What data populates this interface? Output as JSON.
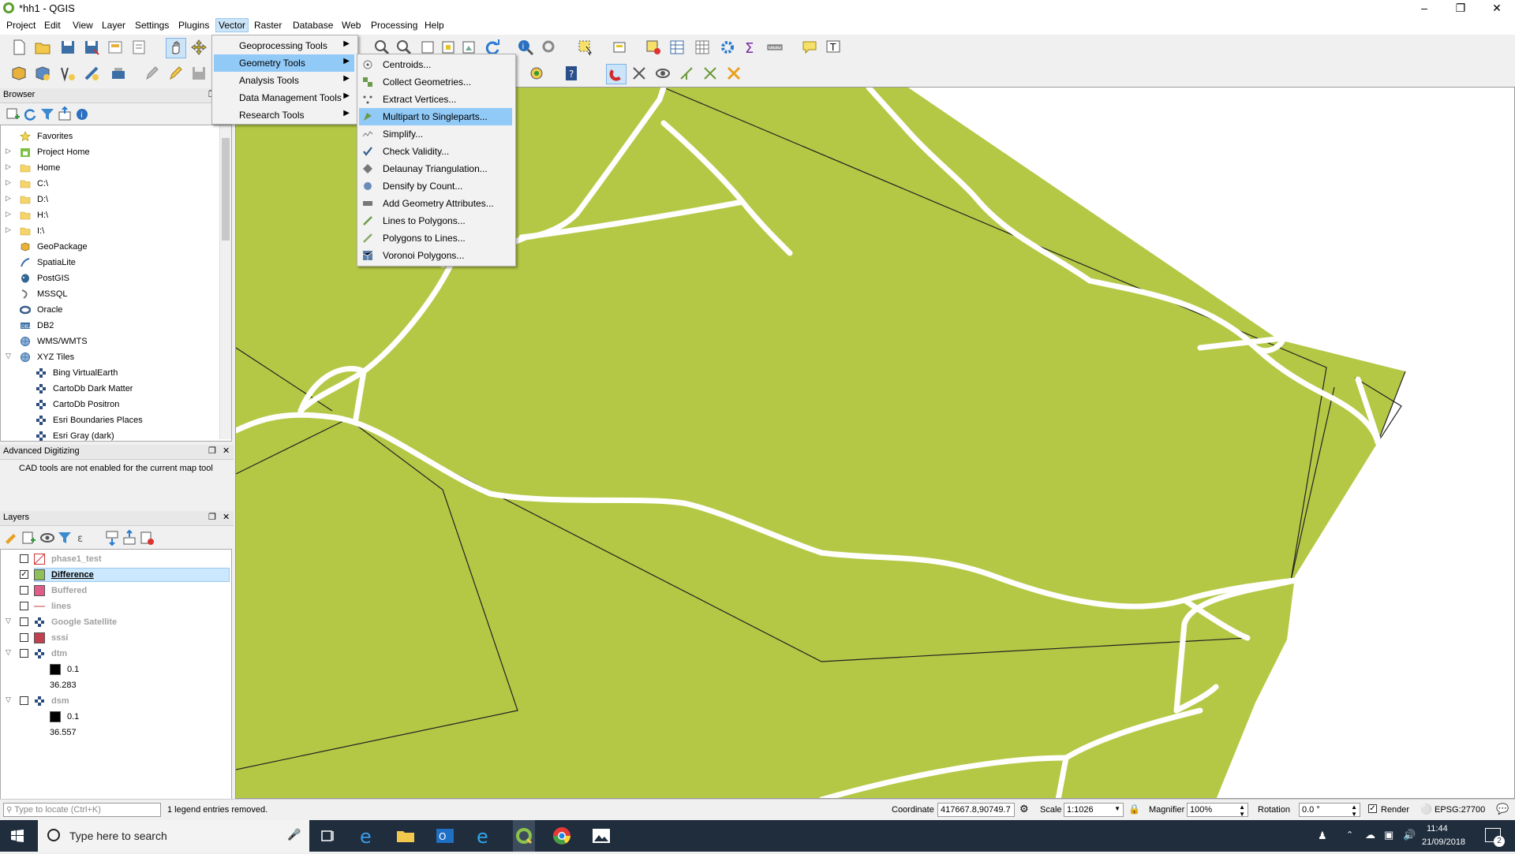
{
  "window": {
    "title": "*hh1 - QGIS"
  },
  "menubar": [
    "Project",
    "Edit",
    "View",
    "Layer",
    "Settings",
    "Plugins",
    "Vector",
    "Raster",
    "Database",
    "Web",
    "Processing",
    "Help"
  ],
  "vector_menu": {
    "items": [
      "Geoprocessing Tools",
      "Geometry Tools",
      "Analysis Tools",
      "Data Management Tools",
      "Research Tools"
    ],
    "highlighted": "Geometry Tools"
  },
  "geometry_submenu": {
    "items": [
      "Centroids...",
      "Collect Geometries...",
      "Extract Vertices...",
      "Multipart to Singleparts...",
      "Simplify...",
      "Check Validity...",
      "Delaunay Triangulation...",
      "Densify by Count...",
      "Add Geometry Attributes...",
      "Lines to Polygons...",
      "Polygons to Lines...",
      "Voronoi Polygons..."
    ],
    "highlighted": "Multipart to Singleparts..."
  },
  "browser": {
    "title": "Browser",
    "items": [
      {
        "label": "Favorites",
        "icon": "star-icon",
        "indent": 0,
        "arrow": ""
      },
      {
        "label": "Project Home",
        "icon": "project-home-icon",
        "indent": 0,
        "arrow": "▷"
      },
      {
        "label": "Home",
        "icon": "folder-icon",
        "indent": 0,
        "arrow": "▷"
      },
      {
        "label": "C:\\",
        "icon": "folder-icon",
        "indent": 0,
        "arrow": "▷"
      },
      {
        "label": "D:\\",
        "icon": "folder-icon",
        "indent": 0,
        "arrow": "▷"
      },
      {
        "label": "H:\\",
        "icon": "folder-icon",
        "indent": 0,
        "arrow": "▷"
      },
      {
        "label": "I:\\",
        "icon": "folder-icon",
        "indent": 0,
        "arrow": "▷"
      },
      {
        "label": "GeoPackage",
        "icon": "geopackage-icon",
        "indent": 0,
        "arrow": ""
      },
      {
        "label": "SpatiaLite",
        "icon": "spatialite-icon",
        "indent": 0,
        "arrow": ""
      },
      {
        "label": "PostGIS",
        "icon": "postgis-icon",
        "indent": 0,
        "arrow": ""
      },
      {
        "label": "MSSQL",
        "icon": "mssql-icon",
        "indent": 0,
        "arrow": ""
      },
      {
        "label": "Oracle",
        "icon": "oracle-icon",
        "indent": 0,
        "arrow": ""
      },
      {
        "label": "DB2",
        "icon": "db2-icon",
        "indent": 0,
        "arrow": ""
      },
      {
        "label": "WMS/WMTS",
        "icon": "wms-icon",
        "indent": 0,
        "arrow": ""
      },
      {
        "label": "XYZ Tiles",
        "icon": "xyz-icon",
        "indent": 0,
        "arrow": "▽"
      },
      {
        "label": "Bing VirtualEarth",
        "icon": "tile-icon",
        "indent": 1,
        "arrow": ""
      },
      {
        "label": "CartoDb Dark Matter",
        "icon": "tile-icon",
        "indent": 1,
        "arrow": ""
      },
      {
        "label": "CartoDb Positron",
        "icon": "tile-icon",
        "indent": 1,
        "arrow": ""
      },
      {
        "label": "Esri Boundaries Places",
        "icon": "tile-icon",
        "indent": 1,
        "arrow": ""
      },
      {
        "label": "Esri Gray (dark)",
        "icon": "tile-icon",
        "indent": 1,
        "arrow": ""
      }
    ]
  },
  "advanced_digitizing": {
    "title": "Advanced Digitizing",
    "message": "CAD tools are not enabled for the current map tool"
  },
  "layers": {
    "title": "Layers",
    "items": [
      {
        "label": "phase1_test",
        "checked": false,
        "swatch": "#ffffff",
        "swatch_type": "hatch",
        "bold": false,
        "greyed": true,
        "arrow": "",
        "indent": 0
      },
      {
        "label": "Difference",
        "checked": true,
        "swatch": "#8fbf5a",
        "swatch_type": "fill",
        "bold": true,
        "greyed": false,
        "arrow": "",
        "indent": 0,
        "selected": true
      },
      {
        "label": "Buffered",
        "checked": false,
        "swatch": "#e05a8a",
        "swatch_type": "fill",
        "bold": false,
        "greyed": true,
        "arrow": "",
        "indent": 0
      },
      {
        "label": "lines",
        "checked": false,
        "swatch": "#e0a0a0",
        "swatch_type": "line",
        "bold": false,
        "greyed": true,
        "arrow": "",
        "indent": 0
      },
      {
        "label": "Google Satellite",
        "checked": false,
        "swatch": "#335577",
        "swatch_type": "tile",
        "bold": false,
        "greyed": true,
        "arrow": "▽",
        "indent": 0
      },
      {
        "label": "sssi",
        "checked": false,
        "swatch": "#c04050",
        "swatch_type": "fill",
        "bold": false,
        "greyed": true,
        "arrow": "",
        "indent": 0
      },
      {
        "label": "dtm",
        "checked": false,
        "swatch": "#335577",
        "swatch_type": "tile",
        "bold": false,
        "greyed": true,
        "arrow": "▽",
        "indent": 0
      },
      {
        "label": "0.1",
        "checked": null,
        "swatch": "#000000",
        "swatch_type": "fill",
        "bold": false,
        "greyed": false,
        "arrow": "",
        "indent": 1
      },
      {
        "label": "36.283",
        "checked": null,
        "swatch": "",
        "swatch_type": "none",
        "bold": false,
        "greyed": false,
        "arrow": "",
        "indent": 1
      },
      {
        "label": "dsm",
        "checked": false,
        "swatch": "#335577",
        "swatch_type": "tile",
        "bold": false,
        "greyed": true,
        "arrow": "▽",
        "indent": 0
      },
      {
        "label": "0.1",
        "checked": null,
        "swatch": "#000000",
        "swatch_type": "fill",
        "bold": false,
        "greyed": false,
        "arrow": "",
        "indent": 1
      },
      {
        "label": "36.557",
        "checked": null,
        "swatch": "",
        "swatch_type": "none",
        "bold": false,
        "greyed": false,
        "arrow": "",
        "indent": 1
      }
    ]
  },
  "statusbar": {
    "locate_placeholder": "Type to locate (Ctrl+K)",
    "message": "1 legend entries removed.",
    "coordinate_label": "Coordinate",
    "coordinate_value": "417667.8,90749.7",
    "scale_label": "Scale",
    "scale_value": "1:1026",
    "magnifier_label": "Magnifier",
    "magnifier_value": "100%",
    "rotation_label": "Rotation",
    "rotation_value": "0.0 °",
    "render_label": "Render",
    "crs": "EPSG:27700"
  },
  "taskbar": {
    "search_placeholder": "Type here to search",
    "time": "11:44",
    "date": "21/09/2018",
    "notification_count": "2"
  },
  "colors": {
    "polygon_fill": "#b5c845",
    "menu_highlight": "#91c9f7",
    "taskbar": "#1f2d3d"
  }
}
